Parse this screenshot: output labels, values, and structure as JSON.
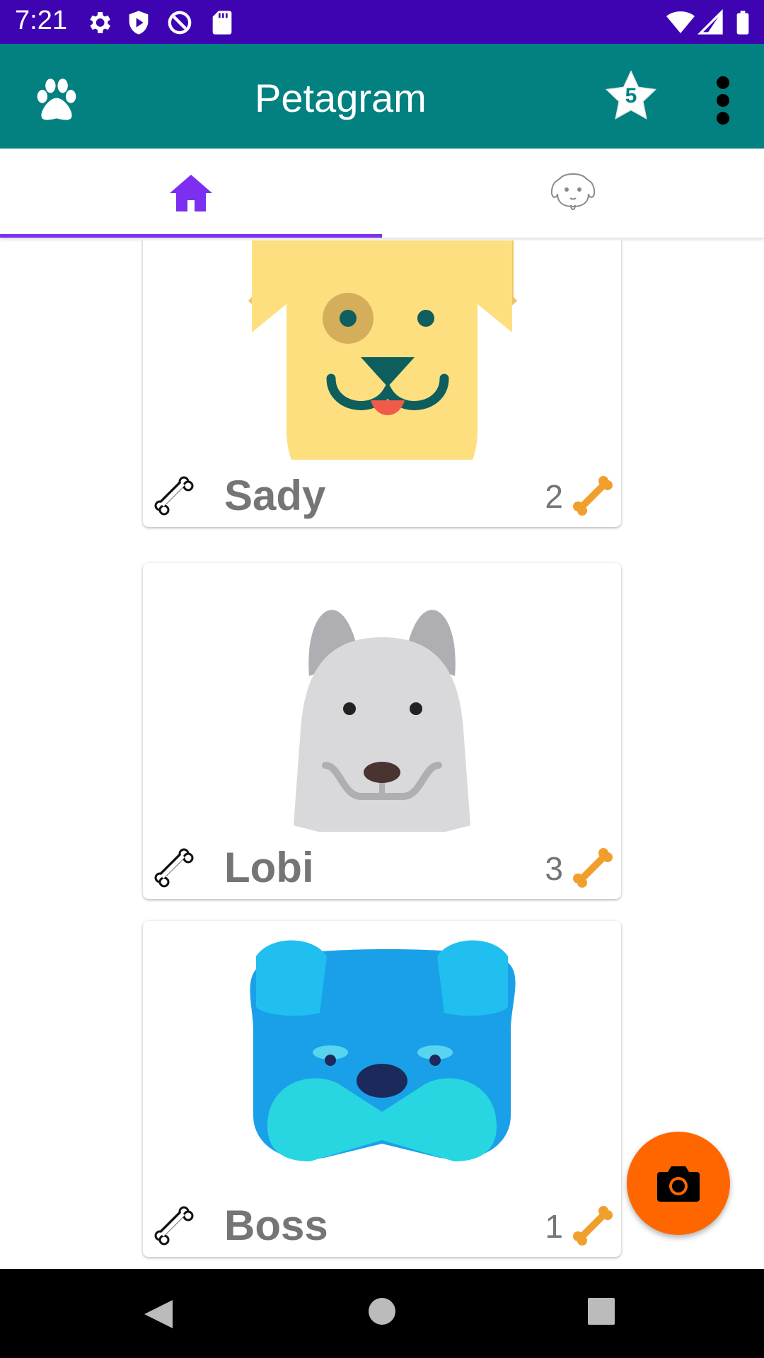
{
  "status_bar": {
    "time": "7:21",
    "icons_left": [
      "settings-icon",
      "play-protect-icon",
      "sync-icon",
      "sd-card-icon"
    ],
    "icons_right": [
      "wifi-icon",
      "signal-icon",
      "battery-icon"
    ]
  },
  "app_bar": {
    "title": "Petagram",
    "leading_icon": "paw-icon",
    "favorites_badge": "5",
    "menu_icon": "more-vert-icon"
  },
  "tabs": [
    {
      "icon": "home-icon",
      "selected": true
    },
    {
      "icon": "dog-outline-icon",
      "selected": false
    }
  ],
  "pets": [
    {
      "name": "Sady",
      "likes": "2",
      "image": "yellow-dog"
    },
    {
      "name": "Lobi",
      "likes": "3",
      "image": "gray-dog"
    },
    {
      "name": "Boss",
      "likes": "1",
      "image": "blue-bulldog"
    }
  ],
  "fab": {
    "icon": "camera-icon"
  },
  "nav_bar": {
    "icons": [
      "back-icon",
      "home-circle-icon",
      "recents-icon"
    ]
  },
  "colors": {
    "status_bar": "#3f04b1",
    "app_bar": "#038080",
    "tab_accent": "#7c2ff0",
    "fab": "#ff6600",
    "bone_orange": "#f19f2c"
  }
}
